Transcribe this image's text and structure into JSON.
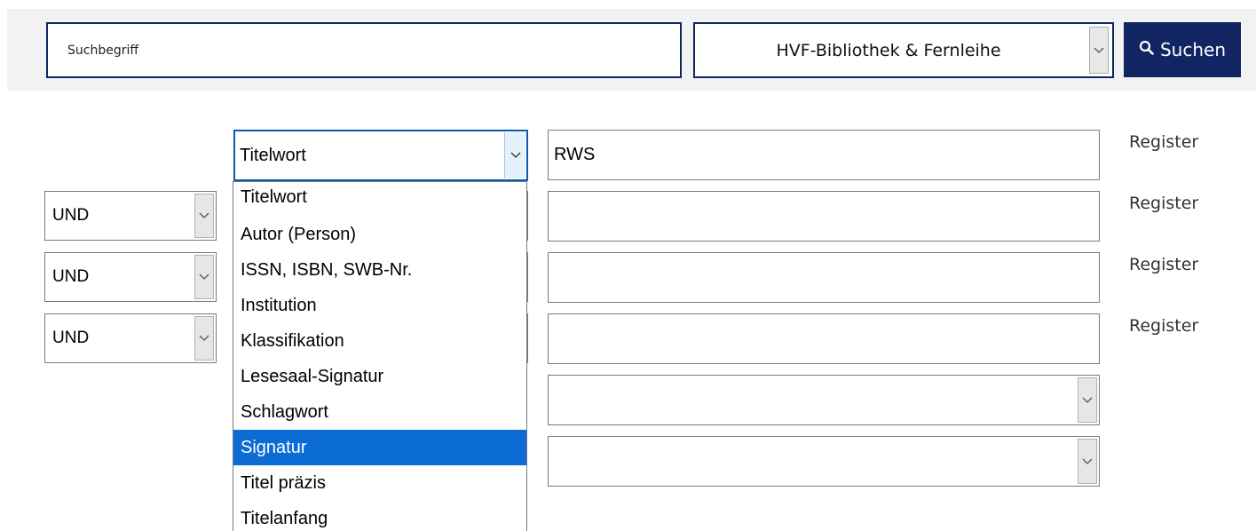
{
  "search": {
    "placeholder": "Suchbegriff",
    "scope_value": "HVF-Bibliothek & Fernleihe",
    "button_label": "Suchen"
  },
  "advanced": {
    "rows": [
      {
        "operator": null,
        "field": "Titelwort",
        "value": "RWS",
        "register_label": "Register"
      },
      {
        "operator": "UND",
        "field": null,
        "value": "",
        "register_label": "Register"
      },
      {
        "operator": "UND",
        "field": null,
        "value": "",
        "register_label": "Register"
      },
      {
        "operator": "UND",
        "field": null,
        "value": "",
        "register_label": "Register"
      }
    ],
    "extra_selects": [
      {
        "value": ""
      },
      {
        "value": ""
      }
    ]
  },
  "field_dropdown": {
    "options": [
      "Titelwort",
      "Autor (Person)",
      "ISSN, ISBN, SWB-Nr.",
      "Institution",
      "Klassifikation",
      "Lesesaal-Signatur",
      "Schlagwort",
      "Signatur",
      "Titel präzis",
      "Titelanfang"
    ],
    "highlighted": "Signatur"
  },
  "colors": {
    "brand": "#112563",
    "focus": "#0b59b5",
    "highlight": "#0b6cd6",
    "bar_bg": "#f2f2f2"
  },
  "icons": {
    "search_button": "search-icon",
    "select_arrow": "chevron-down-icon"
  }
}
